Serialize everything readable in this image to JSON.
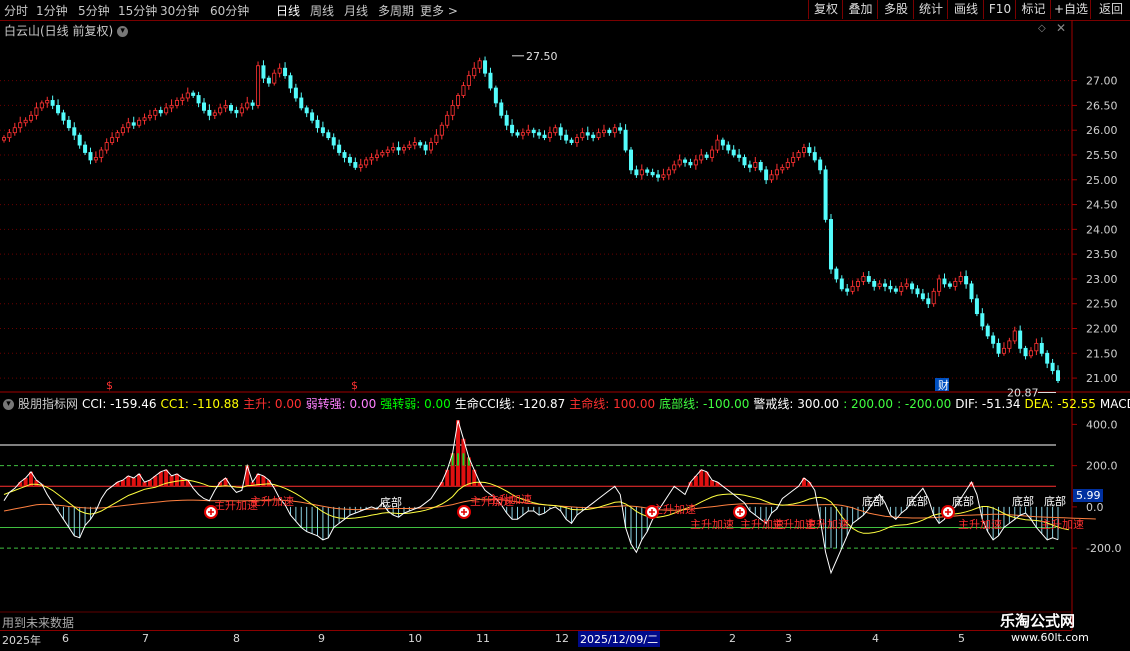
{
  "toolbar": {
    "timeframes": [
      "分时",
      "1分钟",
      "5分钟",
      "15分钟",
      "30分钟",
      "60分钟",
      "日线",
      "周线",
      "月线",
      "多周期",
      "更多 >"
    ],
    "active_timeframe": "日线",
    "right_buttons": [
      "复权",
      "叠加",
      "多股",
      "统计",
      "画线",
      "F10",
      "标记",
      "+自选",
      "返回"
    ]
  },
  "title": "白云山(日线 前复权)",
  "indicator_header": [
    {
      "text": "股朋指标网",
      "color": "#cccccc"
    },
    {
      "text": "CCI: -159.46",
      "color": "#ffffff"
    },
    {
      "text": "CC1: -110.88",
      "color": "#ffff00"
    },
    {
      "text": "主升: 0.00",
      "color": "#ff3030"
    },
    {
      "text": "弱转强: 0.00",
      "color": "#ff80ff"
    },
    {
      "text": "强转弱: 0.00",
      "color": "#00ff00"
    },
    {
      "text": "生命CCI线: -120.87",
      "color": "#ffffff"
    },
    {
      "text": "主命线: 100.00",
      "color": "#ff3030"
    },
    {
      "text": "底部线: -100.00",
      "color": "#40ff40"
    },
    {
      "text": "警戒线: 300.00",
      "color": "#ffffff"
    },
    {
      "text": ": 200.00",
      "color": "#40ff40"
    },
    {
      "text": ": -200.00",
      "color": "#40ff40"
    },
    {
      "text": "DIF: -51.34",
      "color": "#ffffff"
    },
    {
      "text": "DEA: -52.55",
      "color": "#ffff00"
    },
    {
      "text": "MACD",
      "color": "#ffffff"
    }
  ],
  "footer_note": "用到未来数据",
  "watermark": {
    "brand": "乐淘公式网",
    "url": "www.60lt.com"
  },
  "chart_data": [
    {
      "type": "candlestick",
      "title": "白云山(日线 前复权)",
      "ylim": [
        20.8,
        27.9
      ],
      "yticks": [
        "21.00",
        "21.50",
        "22.00",
        "22.50",
        "23.00",
        "23.50",
        "24.00",
        "24.50",
        "25.00",
        "25.50",
        "26.00",
        "26.50",
        "27.00"
      ],
      "annotations": [
        {
          "text": "27.50",
          "value": 27.5
        },
        {
          "text": "20.87",
          "value": 20.87
        }
      ],
      "markers": [
        "$",
        "$",
        "财"
      ],
      "up_color": "#ff3232",
      "down_color": "#54fcfc",
      "closes": [
        25.85,
        25.95,
        26.05,
        26.15,
        26.2,
        26.3,
        26.45,
        26.55,
        26.6,
        26.5,
        26.35,
        26.2,
        26.05,
        25.9,
        25.7,
        25.55,
        25.4,
        25.45,
        25.6,
        25.75,
        25.85,
        25.95,
        26.05,
        26.15,
        26.1,
        26.2,
        26.25,
        26.3,
        26.4,
        26.35,
        26.45,
        26.5,
        26.6,
        26.65,
        26.75,
        26.7,
        26.55,
        26.4,
        26.3,
        26.35,
        26.45,
        26.5,
        26.4,
        26.35,
        26.45,
        26.55,
        26.5,
        27.3,
        27.05,
        26.95,
        27.15,
        27.25,
        27.1,
        26.85,
        26.65,
        26.45,
        26.35,
        26.2,
        26.05,
        25.95,
        25.85,
        25.7,
        25.55,
        25.45,
        25.35,
        25.25,
        25.3,
        25.4,
        25.45,
        25.5,
        25.55,
        25.6,
        25.65,
        25.6,
        25.65,
        25.7,
        25.75,
        25.7,
        25.6,
        25.75,
        25.9,
        26.1,
        26.3,
        26.5,
        26.7,
        26.9,
        27.1,
        27.25,
        27.4,
        27.15,
        26.85,
        26.55,
        26.3,
        26.1,
        25.95,
        25.9,
        25.95,
        26.0,
        25.95,
        25.9,
        25.85,
        25.95,
        26.05,
        25.9,
        25.8,
        25.75,
        25.85,
        25.95,
        25.9,
        25.85,
        25.95,
        26.0,
        25.95,
        26.05,
        26.0,
        25.6,
        25.2,
        25.1,
        25.2,
        25.15,
        25.1,
        25.05,
        25.1,
        25.2,
        25.3,
        25.4,
        25.35,
        25.3,
        25.4,
        25.5,
        25.45,
        25.6,
        25.8,
        25.7,
        25.6,
        25.5,
        25.45,
        25.3,
        25.25,
        25.35,
        25.2,
        25.0,
        25.1,
        25.2,
        25.25,
        25.35,
        25.45,
        25.55,
        25.65,
        25.55,
        25.4,
        25.2,
        24.2,
        23.2,
        23.0,
        22.8,
        22.75,
        22.85,
        22.95,
        23.05,
        22.95,
        22.85,
        22.9,
        22.85,
        22.8,
        22.75,
        22.85,
        22.9,
        22.8,
        22.7,
        22.6,
        22.5,
        22.75,
        23.0,
        22.9,
        22.85,
        22.95,
        23.05,
        22.9,
        22.6,
        22.3,
        22.05,
        21.85,
        21.7,
        21.5,
        21.6,
        21.75,
        21.95,
        21.6,
        21.45,
        21.55,
        21.7,
        21.5,
        21.3,
        21.15,
        20.95
      ]
    },
    {
      "type": "indicator",
      "title": "股朋指标网",
      "ylim": [
        -500,
        460
      ],
      "yticks": [
        {
          "text": "400.0",
          "value": 400
        },
        {
          "text": "200.0",
          "value": 200
        },
        {
          "text": "0.0",
          "value": 0
        },
        {
          "text": "-200.0",
          "value": -200
        }
      ],
      "current_value_label": "5.99",
      "reference_lines": [
        {
          "value": 300,
          "color": "#ffffff",
          "style": "solid"
        },
        {
          "value": 200,
          "color": "#40c040",
          "style": "dashed"
        },
        {
          "value": 100,
          "color": "#ff3030",
          "style": "solid"
        },
        {
          "value": -100,
          "color": "#40c040",
          "style": "solid"
        },
        {
          "value": -200,
          "color": "#40c040",
          "style": "dashed"
        }
      ],
      "labels": [
        "主升加速",
        "主升加速",
        "主升加速",
        "主升加速",
        "主升加速",
        "底部",
        "底部",
        "底部",
        "底部",
        "底部",
        "底部",
        "主升加速",
        "主升加速",
        "主升加速",
        "主升加速",
        "主升加速",
        "主升加速"
      ],
      "cci": [
        30,
        70,
        90,
        120,
        140,
        170,
        130,
        110,
        60,
        20,
        -20,
        -60,
        -100,
        -140,
        -150,
        -90,
        -60,
        -20,
        40,
        80,
        100,
        120,
        130,
        150,
        140,
        160,
        120,
        130,
        150,
        170,
        180,
        150,
        160,
        140,
        130,
        90,
        60,
        40,
        30,
        80,
        120,
        140,
        100,
        70,
        80,
        200,
        120,
        160,
        150,
        130,
        90,
        40,
        10,
        -40,
        -70,
        -100,
        -120,
        -130,
        -140,
        -160,
        -150,
        -100,
        -80,
        -60,
        -40,
        -30,
        -20,
        -10,
        0,
        -10,
        20,
        -20,
        -40,
        -50,
        -30,
        -20,
        -10,
        0,
        20,
        40,
        80,
        120,
        180,
        260,
        420,
        330,
        240,
        180,
        120,
        80,
        60,
        40,
        10,
        -30,
        -60,
        -60,
        -40,
        -20,
        -20,
        -40,
        -30,
        -10,
        0,
        -20,
        -60,
        -80,
        -40,
        -20,
        0,
        20,
        40,
        60,
        80,
        100,
        60,
        -100,
        -180,
        -220,
        -160,
        -120,
        -60,
        -20,
        20,
        60,
        100,
        80,
        60,
        120,
        150,
        180,
        170,
        130,
        120,
        100,
        80,
        60,
        40,
        20,
        -20,
        -40,
        -60,
        -80,
        -30,
        -10,
        40,
        60,
        80,
        100,
        140,
        120,
        80,
        -60,
        -220,
        -320,
        -260,
        -200,
        -140,
        -80,
        -60,
        -40,
        -10,
        30,
        60,
        20,
        -40,
        -60,
        -30,
        -10,
        30,
        60,
        90,
        40,
        -40,
        -80,
        -60,
        -20,
        0,
        40,
        80,
        120,
        60,
        -60,
        -120,
        -160,
        -140,
        -100,
        -80,
        -60,
        -40,
        -30,
        -60,
        -100,
        -130,
        -160,
        -150,
        -159
      ],
      "cc1": [
        60,
        70,
        80,
        90,
        100,
        110,
        110,
        105,
        95,
        80,
        60,
        40,
        20,
        0,
        -20,
        -30,
        -35,
        -30,
        -20,
        -5,
        10,
        25,
        40,
        55,
        65,
        75,
        85,
        90,
        95,
        105,
        115,
        120,
        125,
        128,
        130,
        125,
        118,
        110,
        100,
        98,
        100,
        102,
        100,
        96,
        94,
        102,
        104,
        108,
        110,
        112,
        108,
        100,
        90,
        78,
        64,
        48,
        30,
        12,
        -6,
        -24,
        -38,
        -48,
        -54,
        -56,
        -56,
        -54,
        -50,
        -46,
        -40,
        -36,
        -30,
        -28,
        -30,
        -32,
        -32,
        -30,
        -26,
        -22,
        -16,
        -8,
        2,
        14,
        30,
        50,
        80,
        100,
        112,
        118,
        120,
        118,
        112,
        102,
        90,
        76,
        60,
        46,
        36,
        28,
        20,
        14,
        10,
        8,
        6,
        2,
        -4,
        -12,
        -14,
        -14,
        -12,
        -8,
        -2,
        6,
        14,
        22,
        24,
        14,
        -2,
        -22,
        -36,
        -46,
        -50,
        -50,
        -46,
        -40,
        -30,
        -20,
        -10,
        0,
        10,
        24,
        36,
        48,
        56,
        60,
        62,
        62,
        60,
        56,
        50,
        44,
        36,
        26,
        16,
        10,
        8,
        10,
        14,
        20,
        28,
        38,
        44,
        46,
        40,
        24,
        -8,
        -46,
        -80,
        -104,
        -120,
        -128,
        -128,
        -124,
        -118,
        -108,
        -96,
        -90,
        -88,
        -86,
        -80,
        -74,
        -64,
        -52,
        -40,
        -34,
        -32,
        -34,
        -34,
        -30,
        -24,
        -16,
        -6,
        2,
        2,
        -6,
        -18,
        -32,
        -44,
        -52,
        -58,
        -62,
        -64,
        -66,
        -70,
        -78,
        -88,
        -98,
        -106,
        -111
      ],
      "life": [
        -20,
        -15,
        -10,
        -5,
        0,
        5,
        10,
        12,
        12,
        10,
        8,
        5,
        2,
        0,
        -3,
        -5,
        -6,
        -6,
        -5,
        -3,
        0,
        3,
        6,
        9,
        12,
        15,
        18,
        20,
        22,
        25,
        28,
        30,
        31,
        32,
        33,
        33,
        32,
        31,
        30,
        30,
        30,
        30,
        30,
        29,
        29,
        30,
        31,
        32,
        33,
        34,
        34,
        33,
        31,
        29,
        26,
        22,
        18,
        13,
        8,
        3,
        -2,
        -6,
        -9,
        -11,
        -12,
        -13,
        -13,
        -12,
        -11,
        -10,
        -9,
        -8,
        -8,
        -8,
        -8,
        -8,
        -7,
        -6,
        -5,
        -3,
        -1,
        2,
        6,
        11,
        18,
        24,
        29,
        33,
        36,
        37,
        37,
        36,
        34,
        31,
        28,
        24,
        21,
        18,
        15,
        12,
        10,
        8,
        6,
        4,
        2,
        0,
        -2,
        -3,
        -4,
        -4,
        -3,
        -2,
        0,
        2,
        4,
        5,
        4,
        2,
        -2,
        -6,
        -10,
        -13,
        -15,
        -16,
        -16,
        -15,
        -13,
        -11,
        -8,
        -5,
        -2,
        1,
        4,
        7,
        10,
        12,
        14,
        15,
        16,
        16,
        15,
        14,
        13,
        11,
        9,
        8,
        7,
        7,
        7,
        8,
        9,
        10,
        11,
        11,
        10,
        7,
        2,
        -5,
        -14,
        -22,
        -30,
        -36,
        -41,
        -45,
        -48,
        -50,
        -52,
        -53,
        -54,
        -54,
        -54,
        -53,
        -52,
        -50,
        -48,
        -46,
        -44,
        -42,
        -41,
        -40,
        -39,
        -38,
        -37,
        -36,
        -36,
        -37,
        -38,
        -40,
        -42,
        -44,
        -46,
        -48,
        -49,
        -50,
        -51,
        -52,
        -53,
        -54,
        -55,
        -56,
        -57,
        -58,
        -59
      ]
    }
  ],
  "date_axis": {
    "labels": [
      "2025年",
      "6",
      "7",
      "8",
      "9",
      "10",
      "11",
      "12",
      "2",
      "3",
      "4",
      "5"
    ],
    "selected_date": "2025/12/09/二"
  }
}
